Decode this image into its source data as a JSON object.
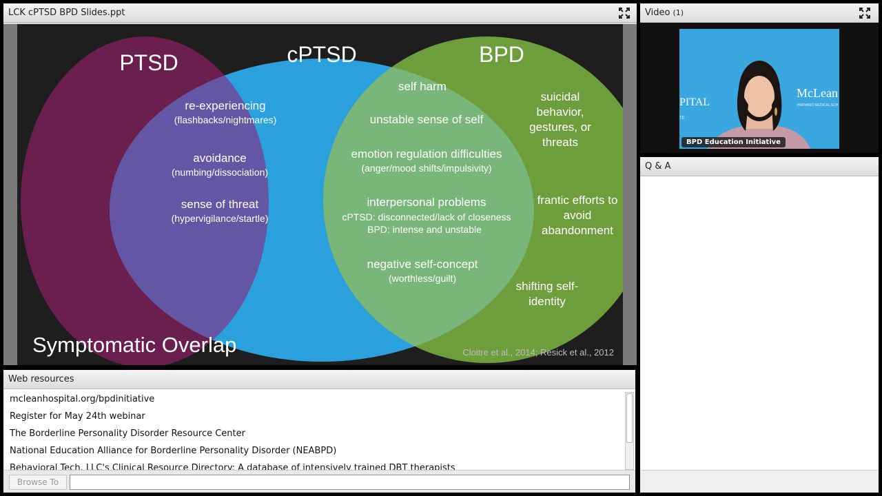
{
  "slide_panel": {
    "title": "LCK cPTSD  BPD Slides.ppt"
  },
  "slide": {
    "circles": {
      "ptsd": {
        "label": "PTSD",
        "color": "#6a1f4e"
      },
      "cptsd": {
        "label": "cPTSD",
        "color": "#2aa1dc"
      },
      "bpd": {
        "label": "BPD",
        "color": "#6e9d3c"
      },
      "overlap_ptsd_cptsd": "#6456a4",
      "overlap_cptsd_bpd": "#79b67a"
    },
    "ptsd_cptsd_items": [
      {
        "main": "re-experiencing",
        "sub": "(flashbacks/nightmares)"
      },
      {
        "main": "avoidance",
        "sub": "(numbing/dissociation)"
      },
      {
        "main": "sense of threat",
        "sub": "(hypervigilance/startle)"
      }
    ],
    "cptsd_bpd_items": {
      "self_harm": "self harm",
      "unstable_self": "unstable sense of self",
      "emotion_main": "emotion regulation difficulties",
      "emotion_sub": "(anger/mood shifts/impulsivity)",
      "interpersonal_main": "interpersonal problems",
      "interpersonal_sub1": "cPTSD: disconnected/lack of closeness",
      "interpersonal_sub2": "BPD: intense and unstable",
      "negative_main": "negative self-concept",
      "negative_sub": "(worthless/guilt)"
    },
    "bpd_items": {
      "suicidal": [
        "suicidal",
        "behavior,",
        "gestures, or",
        "threats"
      ],
      "frantic": [
        "frantic efforts to",
        "avoid",
        "abandonment"
      ],
      "shifting": [
        "shifting self-",
        "identity"
      ]
    },
    "footer_title": "Symptomatic Overlap",
    "citation": "Cloitre et al., 2014; Resick et al., 2012"
  },
  "video_panel": {
    "title": "Video",
    "count": "(1)",
    "caption": "BPD Education Initiative",
    "bg_logo_left": "PITAL",
    "bg_logo_left_sub": "TE",
    "bg_logo_right": "McLean",
    "bg_logo_right_sub": "HARVARD MEDICAL SCH"
  },
  "qa_panel": {
    "title": "Q & A"
  },
  "web_panel": {
    "title": "Web resources",
    "items": [
      "mcleanhospital.org/bpdinitiative",
      "Register for May 24th webinar",
      "The Borderline Personality Disorder Resource Center",
      "National Education Alliance for Borderline Personality Disorder (NEABPD)",
      "Behavioral Tech, LLC's Clinical Resource Directory: A database of intensively trained DBT therapists"
    ],
    "browse_label": "Browse To",
    "url_value": ""
  }
}
